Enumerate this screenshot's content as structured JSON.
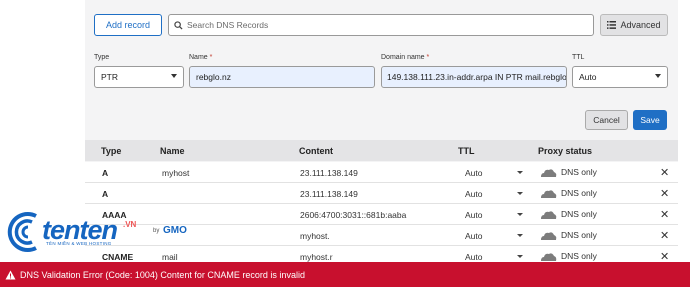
{
  "toolbar": {
    "add_record_label": "Add record",
    "search_placeholder": "Search DNS Records",
    "advanced_label": "Advanced"
  },
  "form": {
    "type_label": "Type",
    "type_value": "PTR",
    "name_label": "Name",
    "name_value": "rebglo.nz",
    "domain_label": "Domain name",
    "domain_value": "149.138.111.23.in-addr.arpa IN PTR mail.rebglo.n",
    "ttl_label": "TTL",
    "ttl_value": "Auto",
    "required_mark": "*",
    "cancel_label": "Cancel",
    "save_label": "Save"
  },
  "table": {
    "headers": {
      "type": "Type",
      "name": "Name",
      "content": "Content",
      "ttl": "TTL",
      "proxy": "Proxy status"
    },
    "rows": [
      {
        "type": "A",
        "name": "myhost",
        "content": "23.111.138.149",
        "ttl": "Auto",
        "proxy": "DNS only"
      },
      {
        "type": "A",
        "name": "",
        "content": "23.111.138.149",
        "ttl": "Auto",
        "proxy": "DNS only"
      },
      {
        "type": "AAAA",
        "name": "",
        "content": "2606:4700:3031::681b:aaba",
        "ttl": "Auto",
        "proxy": "DNS only"
      },
      {
        "type": "",
        "name": "",
        "content": "myhost.",
        "ttl": "Auto",
        "proxy": "DNS only"
      },
      {
        "type": "CNAME",
        "name": "mail",
        "content": "myhost.r",
        "ttl": "Auto",
        "proxy": "DNS only"
      }
    ]
  },
  "watermark": {
    "brand": "tenten",
    "vn": ".VN",
    "sub": "TÊN MIỀN & WEB HOSTING",
    "by": "by",
    "gmo": "GMO"
  },
  "error": {
    "message": "DNS Validation Error (Code: 1004) Content for CNAME record is invalid"
  },
  "colors": {
    "accent": "#1f6fc5",
    "error": "#c8102e",
    "header_bg": "#e4e4e6"
  }
}
